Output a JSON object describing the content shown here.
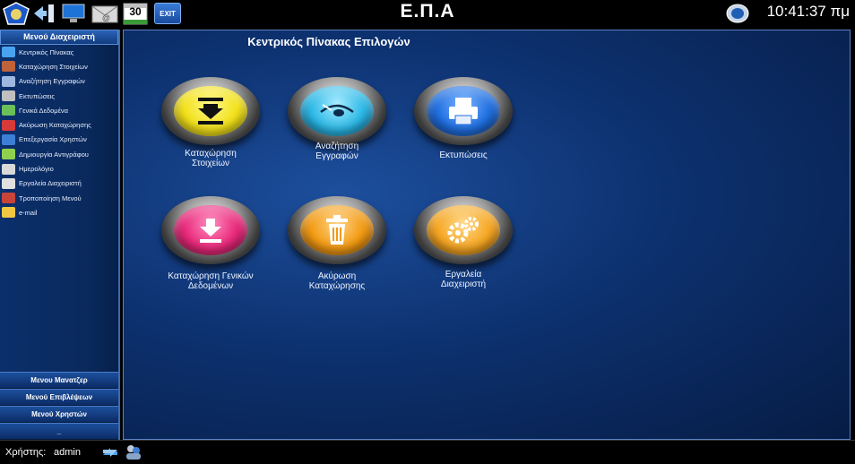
{
  "app": {
    "title": "Ε.Π.Α",
    "clock": "10:41:37 πμ"
  },
  "topbar": {
    "calendar_day": "30",
    "exit_label": "EXIT"
  },
  "sidebar": {
    "header": "Μενού Διαχειριστή",
    "items": [
      {
        "label": "Κεντρικός Πίνακας",
        "icon": "monitor-icon",
        "color": "#4aa3f0"
      },
      {
        "label": "Καταχώρηση Στοιχείων",
        "icon": "books-icon",
        "color": "#c0623a"
      },
      {
        "label": "Αναζήτηση Εγγραφών",
        "icon": "magnifier-icon",
        "color": "#9fb8e0"
      },
      {
        "label": "Εκτυπώσεις",
        "icon": "printer-icon",
        "color": "#bfbfbf"
      },
      {
        "label": "Γενικά Δεδομένα",
        "icon": "chart-icon",
        "color": "#6bbf59"
      },
      {
        "label": "Ακύρωση Καταχώρησης",
        "icon": "cancel-icon",
        "color": "#d83a3a"
      },
      {
        "label": "Επεξεργασία Χρηστών",
        "icon": "users-icon",
        "color": "#3d7fd6"
      },
      {
        "label": "Δημιουργία Αντιγράφου",
        "icon": "copy-icon",
        "color": "#8fd14f"
      },
      {
        "label": "Ημερολόγιο",
        "icon": "calendar-icon",
        "color": "#d9d9d9"
      },
      {
        "label": "Εργαλεία Διαχειριστή",
        "icon": "tools-icon",
        "color": "#e0e0e0"
      },
      {
        "label": "Τροποποίηση Μενού",
        "icon": "gears-icon",
        "color": "#c8443a"
      },
      {
        "label": "e-mail",
        "icon": "folder-mail-icon",
        "color": "#f2c744"
      }
    ],
    "bottom_menus": [
      {
        "label": "Μενου Μανατζερ"
      },
      {
        "label": "Μενού Επιβλέψεων"
      },
      {
        "label": "Μενού Χρηστών"
      },
      {
        "label": "_"
      }
    ]
  },
  "main": {
    "title": "Κεντρικός Πίνακας Επιλογών",
    "tiles": [
      {
        "line1": "Καταχώρηση",
        "line2": "Στοιχείων",
        "icon": "download-tray-icon",
        "color": "#f2e11a"
      },
      {
        "line1": "Αναζήτηση",
        "line2": "Εγγραφών",
        "icon": "eye-search-icon",
        "color": "#2bb8e6"
      },
      {
        "line1": "Εκτυπώσεις",
        "line2": "",
        "icon": "printer-icon",
        "color": "#1f6fe0"
      },
      {
        "line1": "Καταχώρηση Γενικών",
        "line2": "Δεδομένων",
        "icon": "download-icon",
        "color": "#e8287a"
      },
      {
        "line1": "Ακύρωση",
        "line2": "Καταχώρησης",
        "icon": "trash-icon",
        "color": "#f29a12"
      },
      {
        "line1": "Εργαλεία",
        "line2": "Διαχειριστή",
        "icon": "gears-icon",
        "color": "#f5a623"
      }
    ]
  },
  "status": {
    "user_label": "Χρήστης:",
    "username": "admin"
  }
}
